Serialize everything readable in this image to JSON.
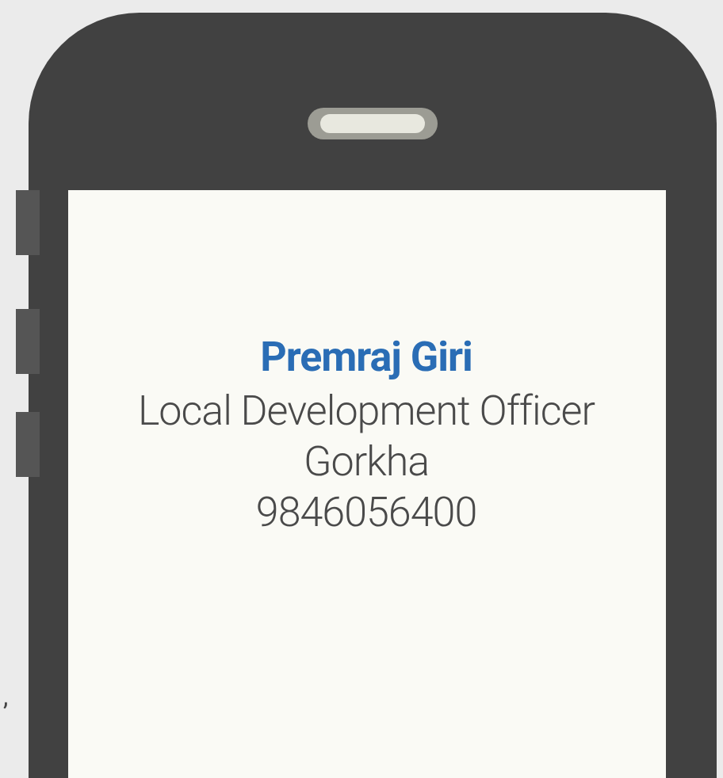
{
  "side_mark": ",",
  "contact": {
    "name": "Premraj Giri",
    "title": "Local Development Officer",
    "district": "Gorkha",
    "phone": "9846056400"
  }
}
